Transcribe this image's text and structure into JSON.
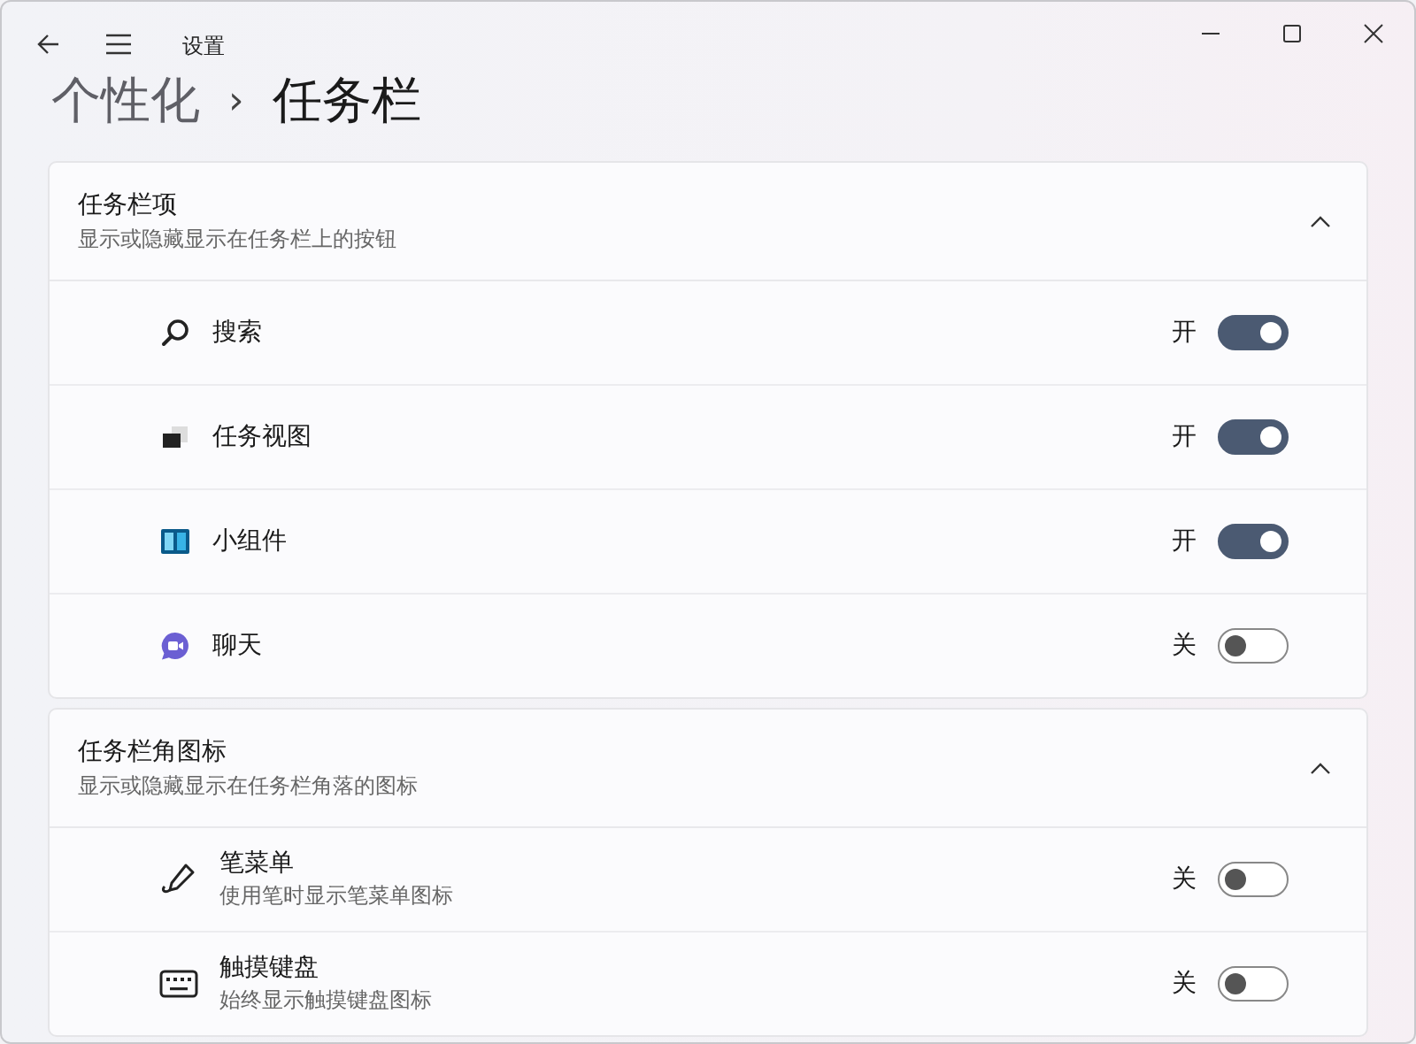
{
  "window": {
    "title": "设置"
  },
  "breadcrumb": {
    "parent": "个性化",
    "separator": "›",
    "current": "任务栏"
  },
  "sections": [
    {
      "title": "任务栏项",
      "subtitle": "显示或隐藏显示在任务栏上的按钮",
      "expanded": true,
      "items": [
        {
          "kind": "search",
          "label": "搜索",
          "state_text": "开",
          "on": true
        },
        {
          "kind": "taskview",
          "label": "任务视图",
          "state_text": "开",
          "on": true
        },
        {
          "kind": "widgets",
          "label": "小组件",
          "state_text": "开",
          "on": true
        },
        {
          "kind": "chat",
          "label": "聊天",
          "state_text": "关",
          "on": false
        }
      ]
    },
    {
      "title": "任务栏角图标",
      "subtitle": "显示或隐藏显示在任务栏角落的图标",
      "expanded": true,
      "items": [
        {
          "kind": "pen",
          "label": "笔菜单",
          "description": "使用笔时显示笔菜单图标",
          "state_text": "关",
          "on": false
        },
        {
          "kind": "keyboard",
          "label": "触摸键盘",
          "description": "始终显示触摸键盘图标",
          "state_text": "关",
          "on": false
        }
      ]
    }
  ]
}
